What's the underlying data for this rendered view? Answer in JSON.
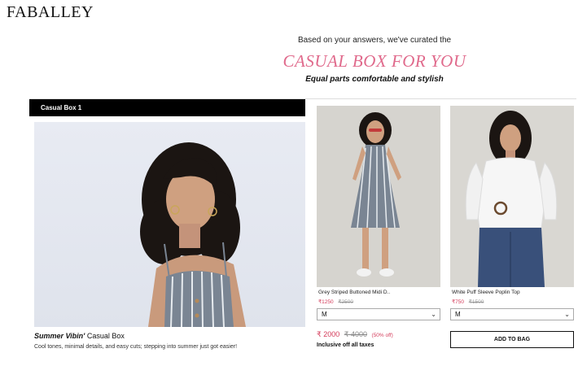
{
  "brand": {
    "logo_text": "FABALLEY"
  },
  "intro": {
    "line1": "Based on your answers, we've curated the",
    "heading": "CASUAL BOX FOR YOU",
    "tagline": "Equal parts comfortable and stylish",
    "heading_color": "#e06a8c"
  },
  "box": {
    "header": "Casual Box 1",
    "title_italic": "Summer Vibin'",
    "title_rest": " Casual Box",
    "description": "Cool tones, minimal details, and easy cuts; stepping into summer just got easier!"
  },
  "products": [
    {
      "name": "Grey Striped Buttoned Midi D..",
      "price": "₹1250",
      "mrp": "₹2500",
      "size": "M"
    },
    {
      "name": "White Puff Sleeve Poplin Top",
      "price": "₹750",
      "mrp": "₹1500",
      "size": "M"
    }
  ],
  "summary": {
    "total": "₹ 2000",
    "mrp_total": "₹ 4000",
    "discount": "(50% off)",
    "tax_note": "Inclusive off all taxes",
    "add_to_bag": "ADD TO BAG"
  },
  "colors": {
    "accent": "#d43b5a",
    "header_bg": "#000000"
  }
}
